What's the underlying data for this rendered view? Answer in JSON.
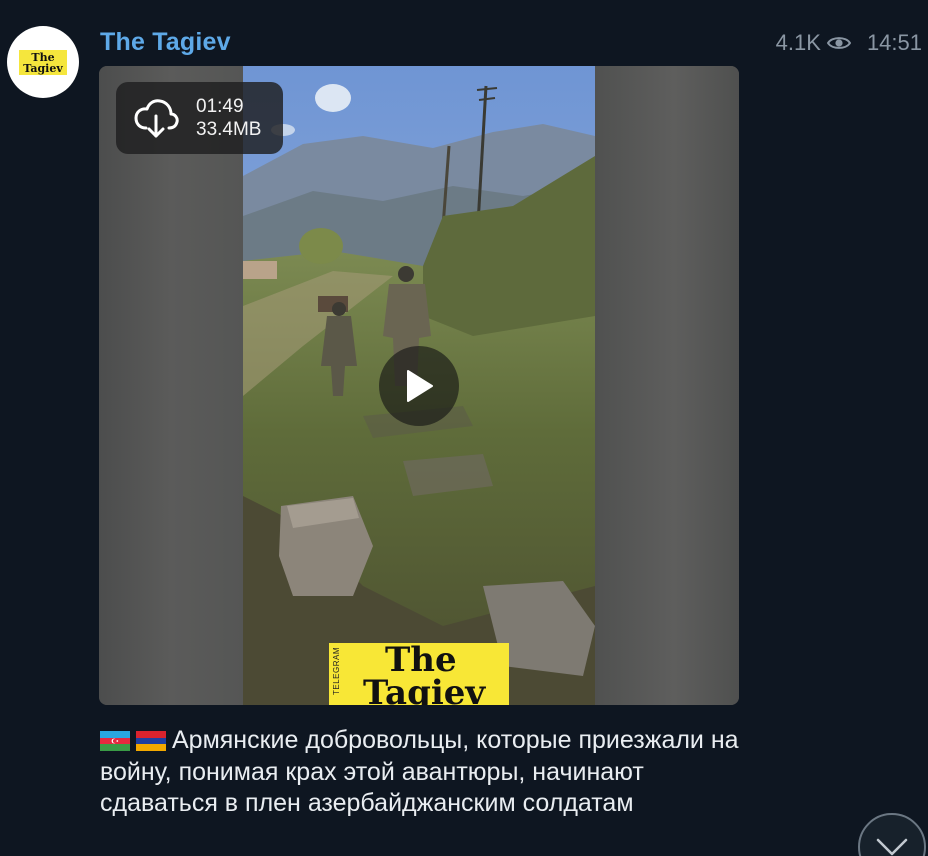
{
  "channel": {
    "name": "The Tagiev",
    "avatar_line1": "The",
    "avatar_line2": "Tagiev"
  },
  "post": {
    "views": "4.1K",
    "time": "14:51",
    "video": {
      "duration": "01:49",
      "size": "33.4MB",
      "watermark_side": "TELEGRAM",
      "watermark_line1": "The",
      "watermark_line2": "Tagiev"
    },
    "caption": {
      "flags": [
        "azerbaijan-flag",
        "armenia-flag"
      ],
      "text": "Армянские добровольцы, которые приезжали на войну, понимая крах этой авантюры, начинают сдаваться в плен азербайджанским солдатам"
    }
  },
  "icons": {
    "views": "eye-icon",
    "download": "cloud-download-icon",
    "play": "play-icon",
    "scroll": "chevron-down-icon"
  },
  "colors": {
    "background": "#0e1621",
    "channel_name": "#5ea9e8",
    "meta_text": "#8a96a3",
    "caption_text": "#e9edf1",
    "watermark": "#f8e736"
  }
}
